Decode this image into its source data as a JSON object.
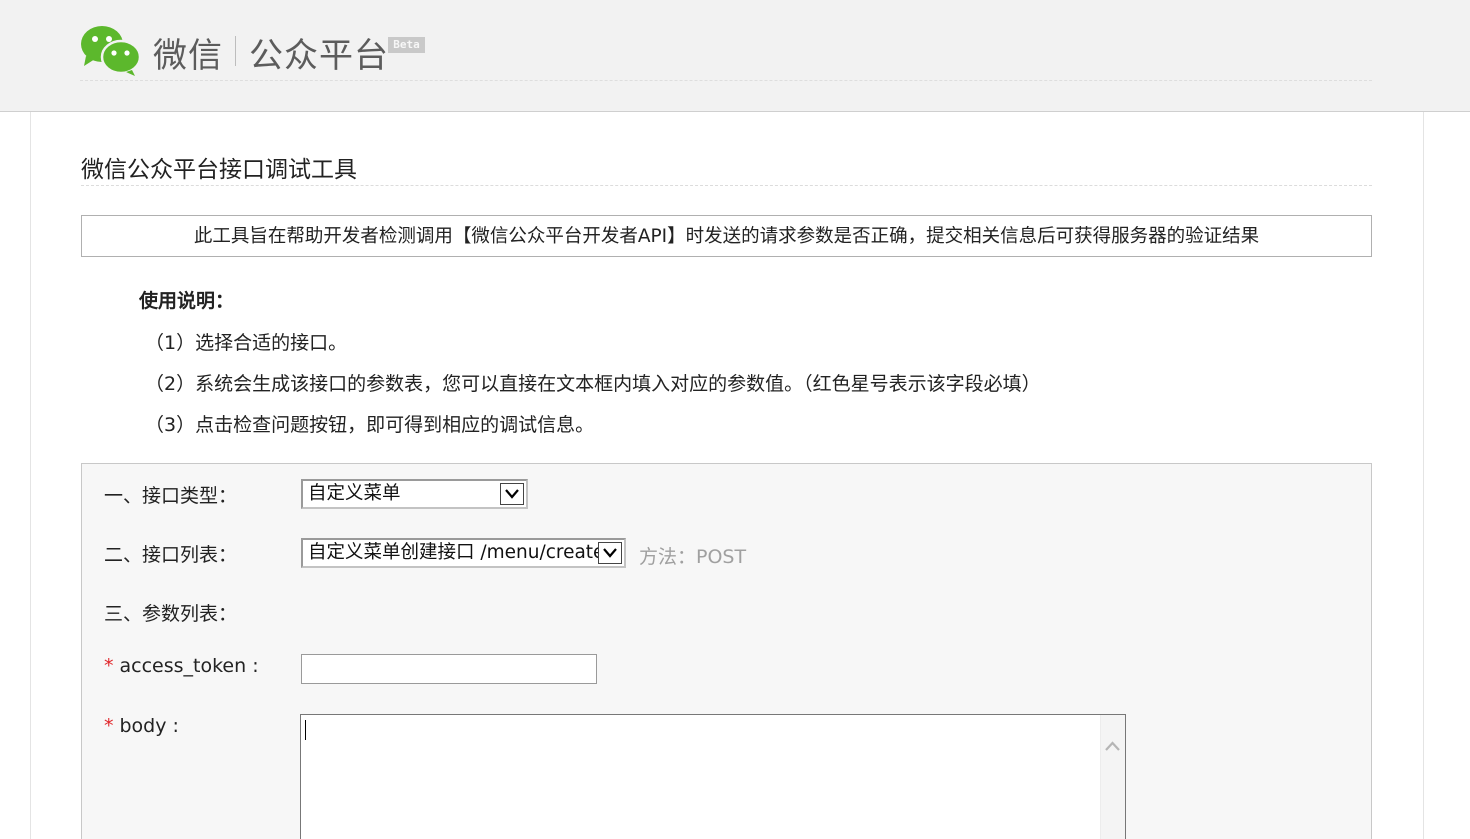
{
  "header": {
    "brand_name": "微信",
    "brand_sub": "公众平台",
    "beta": "Beta",
    "colors": {
      "logo_green": "#5cb82c",
      "header_bg": "#f2f2f2"
    }
  },
  "page": {
    "title": "微信公众平台接口调试工具",
    "notice": "此工具旨在帮助开发者检测调用【微信公众平台开发者API】时发送的请求参数是否正确，提交相关信息后可获得服务器的验证结果"
  },
  "instructions": {
    "title": "使用说明：",
    "steps": [
      "（1）选择合适的接口。",
      "（2）系统会生成该接口的参数表，您可以直接在文本框内填入对应的参数值。（红色星号表示该字段必填）",
      "（3）点击检查问题按钮，即可得到相应的调试信息。"
    ]
  },
  "form": {
    "type_label": "一、接口类型：",
    "type_value": "自定义菜单",
    "list_label": "二、接口列表：",
    "list_value": "自定义菜单创建接口 /menu/create",
    "method": "方法：POST",
    "params_label": "三、参数列表：",
    "required_mark": "*",
    "params": [
      {
        "label": "access_token :",
        "value": ""
      },
      {
        "label": "body :",
        "value": ""
      }
    ]
  },
  "icons": {
    "logo": "wechat-logo-icon",
    "select_arrow": "chevron-down-icon",
    "scroll_up": "chevron-up-icon"
  }
}
